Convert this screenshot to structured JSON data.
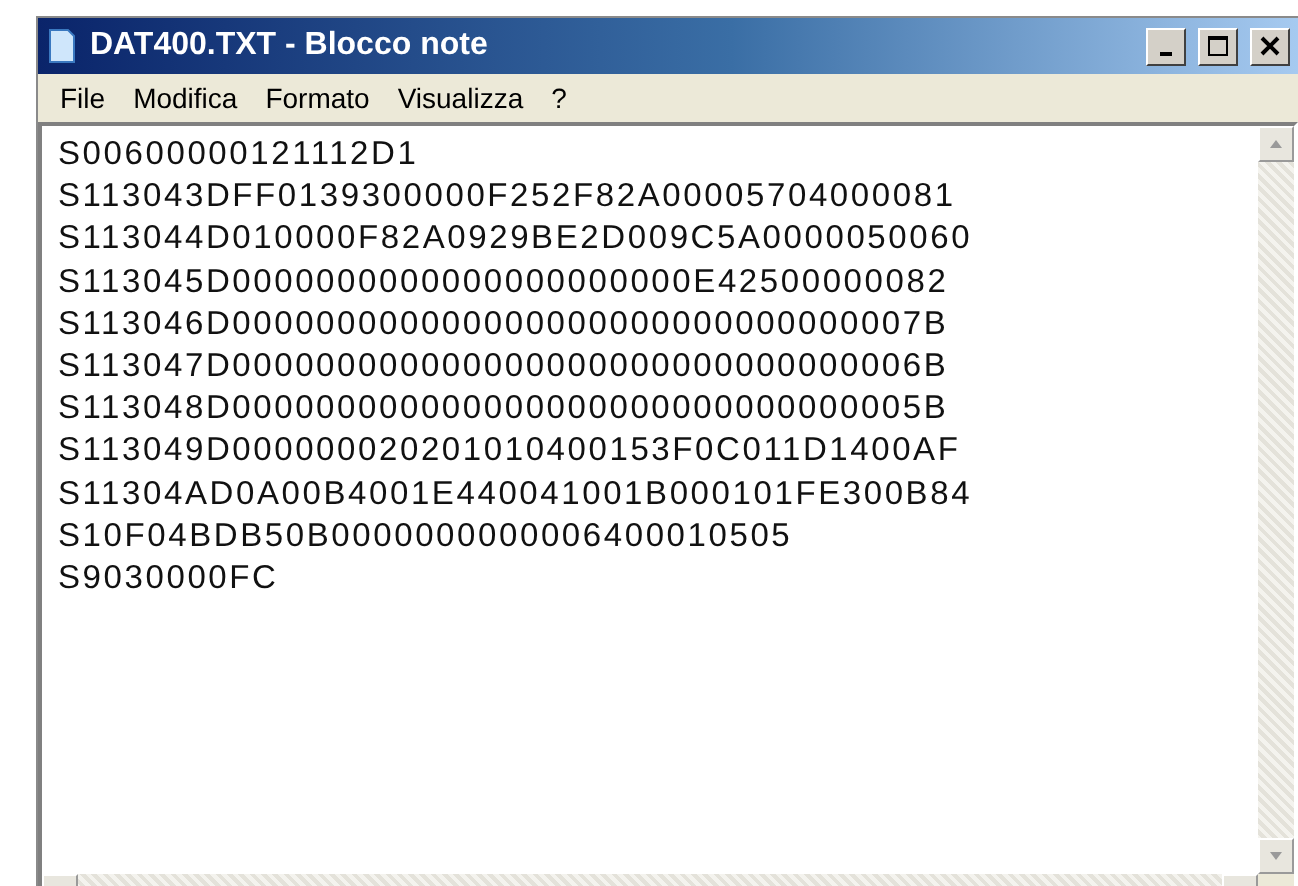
{
  "window": {
    "title": "DAT400.TXT - Blocco note"
  },
  "menu": [
    "File",
    "Modifica",
    "Formato",
    "Visualizza",
    "?"
  ],
  "document": {
    "lines": [
      "S00600000121112D1",
      "S113043DFF0139300000F252F82A00005704000081",
      "S113044D010000F82A0929BE2D009C5A0000050060",
      "S113045D0000000000000000000000E42500000082",
      "S113046D000000000000000000000000000000007B",
      "S113047D000000000000000000000000000000006B",
      "S113048D000000000000000000000000000000005B",
      "S113049D000000020201010400153F0C011D1400AF",
      "S11304AD0A00B4001E440041001B000101FE300B84",
      "S10F04BDB50B0000000000006400010505",
      "S9030000FC"
    ]
  }
}
